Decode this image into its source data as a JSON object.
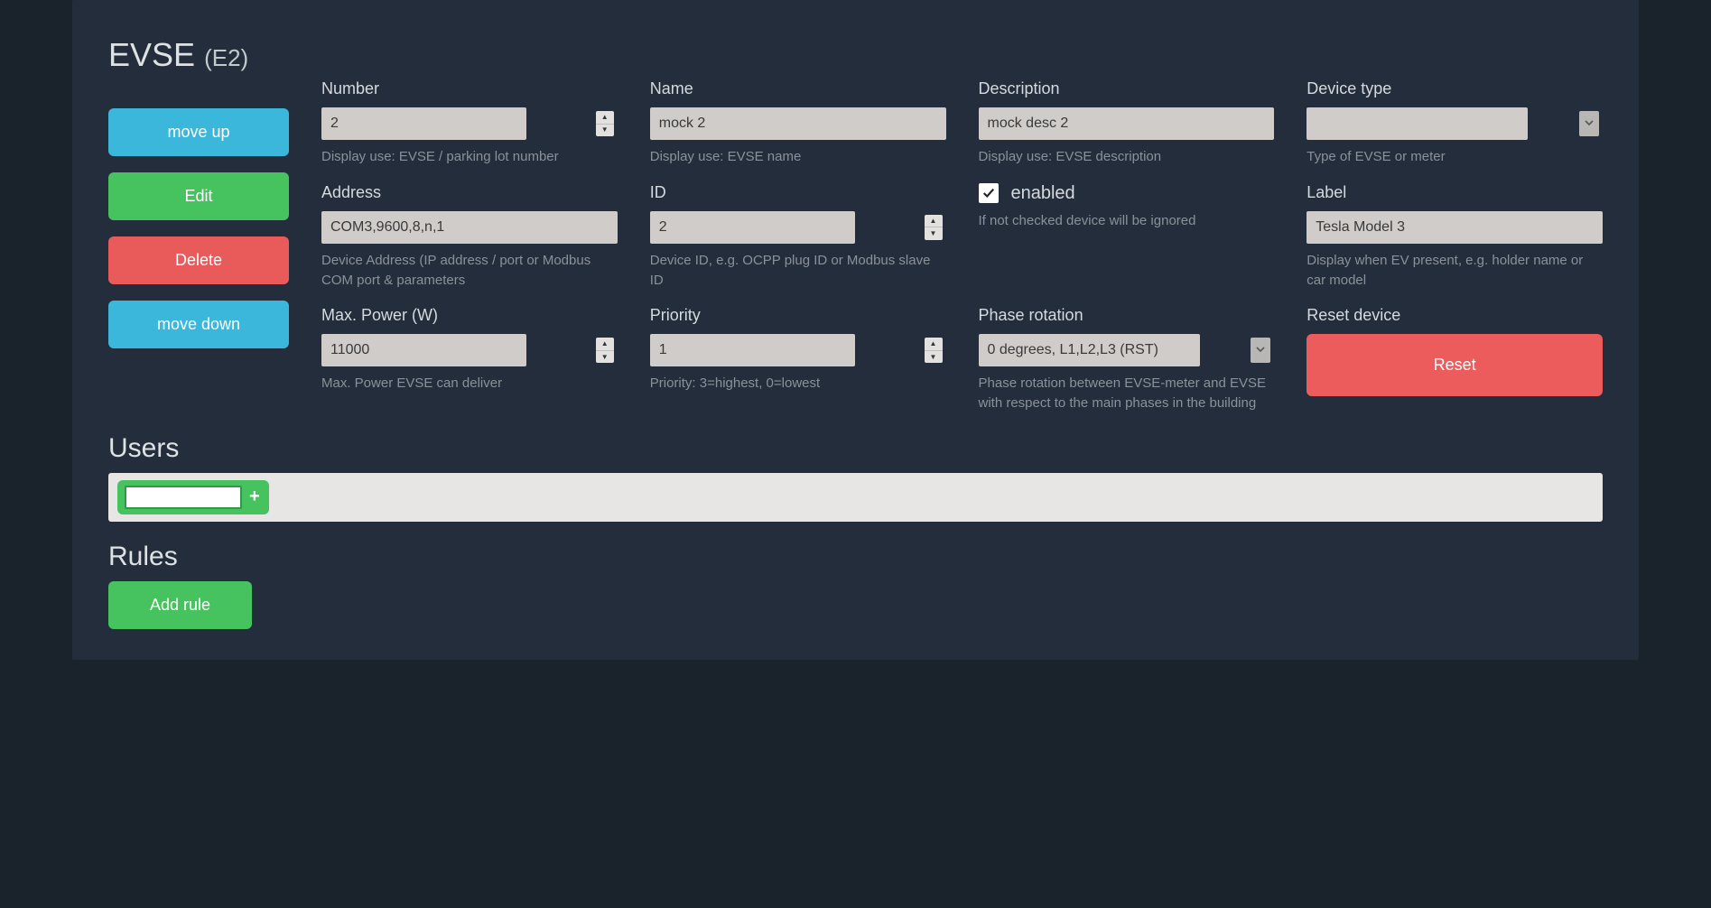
{
  "header": {
    "title_main": "EVSE",
    "title_sub": "(E2)"
  },
  "side_buttons": {
    "move_up": "move up",
    "edit": "Edit",
    "delete": "Delete",
    "move_down": "move down"
  },
  "fields": {
    "number": {
      "label": "Number",
      "value": "2",
      "help": "Display use: EVSE / parking lot number"
    },
    "name": {
      "label": "Name",
      "value": "mock 2",
      "help": "Display use: EVSE name"
    },
    "description": {
      "label": "Description",
      "value": "mock desc 2",
      "help": "Display use: EVSE description"
    },
    "device_type": {
      "label": "Device type",
      "value": "",
      "help": "Type of EVSE or meter"
    },
    "address": {
      "label": "Address",
      "value": "COM3,9600,8,n,1",
      "help": "Device Address (IP address / port or Modbus COM port & parameters"
    },
    "id": {
      "label": "ID",
      "value": "2",
      "help": "Device ID, e.g. OCPP plug ID or Modbus slave ID"
    },
    "enabled": {
      "label": "enabled",
      "checked": true,
      "help": "If not checked device will be ignored"
    },
    "label": {
      "label": "Label",
      "value": "Tesla Model 3",
      "help": "Display when EV present, e.g. holder name or car model"
    },
    "max_power": {
      "label": "Max. Power (W)",
      "value": "11000",
      "help": "Max. Power EVSE can deliver"
    },
    "priority": {
      "label": "Priority",
      "value": "1",
      "help": "Priority: 3=highest, 0=lowest"
    },
    "phase": {
      "label": "Phase rotation",
      "value": "0 degrees, L1,L2,L3 (RST)",
      "help": "Phase rotation between EVSE-meter and EVSE with respect to the main phases in the building"
    },
    "reset": {
      "label": "Reset device",
      "button": "Reset"
    }
  },
  "sections": {
    "users": "Users",
    "rules": "Rules"
  },
  "users": {
    "new_user_value": "",
    "add_symbol": "+"
  },
  "rules": {
    "add_rule": "Add rule"
  }
}
